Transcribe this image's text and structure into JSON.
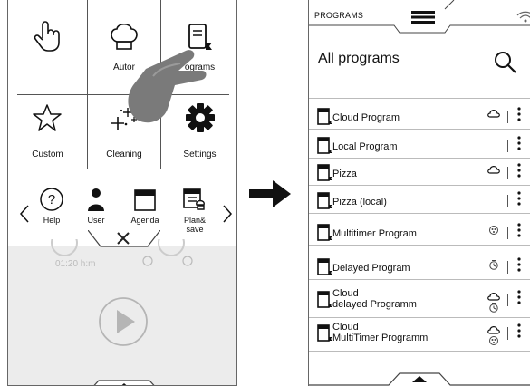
{
  "left_panel": {
    "tiles": {
      "manual": {
        "label": "",
        "icon": "hand-pointer-icon"
      },
      "auto": {
        "label": "Autor",
        "icon": "chef-hat-icon"
      },
      "programs": {
        "label": "ograms",
        "icon": "program-book-icon"
      },
      "custom": {
        "label": "Custom",
        "icon": "star-icon"
      },
      "cleaning": {
        "label": "Cleaning",
        "icon": "sparkle-icon"
      },
      "settings": {
        "label": "Settings",
        "icon": "gear-icon"
      }
    },
    "shortcuts": [
      {
        "label": "Help",
        "icon": "help-icon"
      },
      {
        "label": "User",
        "icon": "user-icon"
      },
      {
        "label": "Agenda",
        "icon": "agenda-icon"
      },
      {
        "label": "Plan&",
        "label2": "save",
        "icon": "plan-save-icon"
      }
    ],
    "time": "01:20 h:m"
  },
  "right_panel": {
    "tab_label": "PROGRAMS",
    "title": "All programs",
    "programs": [
      {
        "name": "Cloud Program",
        "name2": "",
        "cloud": true,
        "timer": false,
        "multitimer": false
      },
      {
        "name": "Local Program",
        "name2": "",
        "cloud": false,
        "timer": false,
        "multitimer": false
      },
      {
        "name": "Pizza",
        "name2": "",
        "cloud": true,
        "timer": false,
        "multitimer": false
      },
      {
        "name": "Pizza (local)",
        "name2": "",
        "cloud": false,
        "timer": false,
        "multitimer": false
      },
      {
        "name": "Multitimer Program",
        "name2": "",
        "cloud": false,
        "timer": false,
        "multitimer": true
      },
      {
        "name": "Delayed Program",
        "name2": "",
        "cloud": false,
        "timer": true,
        "multitimer": false
      },
      {
        "name": "Cloud",
        "name2": "delayed Programm",
        "cloud": true,
        "timer": true,
        "multitimer": false
      },
      {
        "name": "Cloud",
        "name2": "MultiTimer Programm",
        "cloud": true,
        "timer": false,
        "multitimer": true
      }
    ]
  },
  "colors": {
    "line": "#555555",
    "gray": "#ececec",
    "hand": "#7a7a7a"
  }
}
